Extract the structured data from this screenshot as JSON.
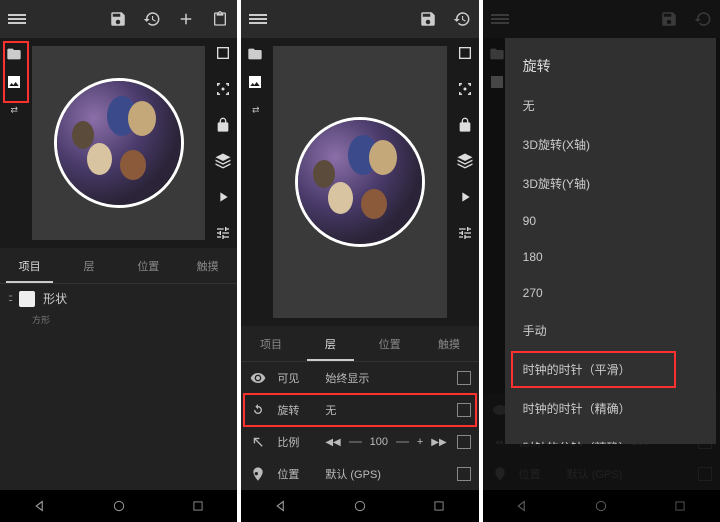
{
  "toolbar": {
    "save_icon": "save",
    "history_icon": "history",
    "add_icon": "plus",
    "paste_icon": "clipboard"
  },
  "right_tools_1": [
    "square",
    "crosshair",
    "lock",
    "layers",
    "play",
    "tune"
  ],
  "right_tools_2": [
    "square",
    "crosshair",
    "lock",
    "layers",
    "play",
    "tune"
  ],
  "tabs_1": [
    "项目",
    "层",
    "位置",
    "触摸"
  ],
  "tabs_2": [
    "项目",
    "层",
    "位置",
    "触摸"
  ],
  "active_tab_1": 0,
  "active_tab_2": 1,
  "shape": {
    "label": "形状",
    "sub": "方形"
  },
  "layer_props": {
    "visible": {
      "label": "可见",
      "value": "始终显示"
    },
    "rotate": {
      "label": "旋转",
      "value": "无"
    },
    "scale": {
      "label": "比例",
      "value": "100"
    },
    "position": {
      "label": "位置",
      "value": "默认 (GPS)"
    }
  },
  "popup": {
    "title": "旋转",
    "items": [
      "无",
      "3D旋转(X轴)",
      "3D旋转(Y轴)",
      "90",
      "180",
      "270",
      "手动",
      "时钟的时针（平滑）",
      "时钟的时针（精确）",
      "时钟的分针（精确）"
    ],
    "highlighted_index": 7
  }
}
